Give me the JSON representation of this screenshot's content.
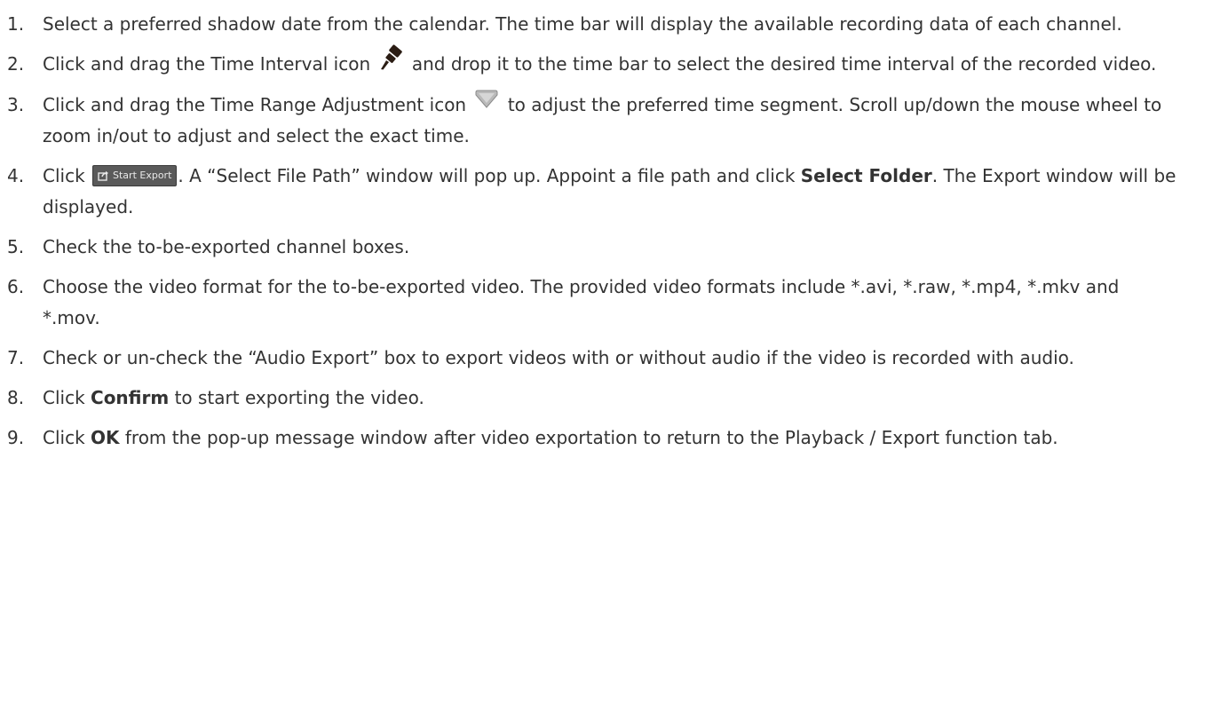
{
  "steps": [
    {
      "num": "1.",
      "text": "Select a preferred shadow date from the calendar. The time bar will display the available recording data of each channel."
    },
    {
      "num": "2.",
      "before": "Click and drag the Time Interval icon",
      "after": "and drop it to the time bar to select the desired time interval of the recorded video.",
      "icon": "time-interval-pin-icon"
    },
    {
      "num": "3.",
      "before": "Click and drag the Time Range Adjustment icon",
      "after": "to adjust the preferred time segment. Scroll up/down the mouse wheel to zoom in/out to adjust and select the exact time.",
      "icon": "time-range-adjustment-icon"
    },
    {
      "num": "4.",
      "before": "Click",
      "button_label": "Start Export",
      "button_icon": "export-icon",
      "middle": ". A “Select File Path” window will pop up. Appoint a file path and click",
      "bold": "Select Folder",
      "after": ". The Export window will be displayed."
    },
    {
      "num": "5.",
      "text": "Check the to-be-exported channel boxes."
    },
    {
      "num": "6.",
      "text": "Choose the video format for the to-be-exported video. The provided video formats include *.avi, *.raw, *.mp4, *.mkv and *.mov."
    },
    {
      "num": "7.",
      "text": "Check or un-check the “Audio Export” box to export videos with or without audio if the video is recorded with audio."
    },
    {
      "num": "8.",
      "before": "Click",
      "bold": "Confirm",
      "after": "to start exporting the video."
    },
    {
      "num": "9.",
      "before": "Click",
      "bold": "OK",
      "after": "from the pop-up message window after video exportation to return to the Playback / Export function tab."
    }
  ],
  "colors": {
    "text": "#333333",
    "button_bg": "#5a5a5a",
    "button_text": "#e9e9e9",
    "pin_icon": "#2b1d14",
    "range_icon": "#a8a8a8"
  }
}
